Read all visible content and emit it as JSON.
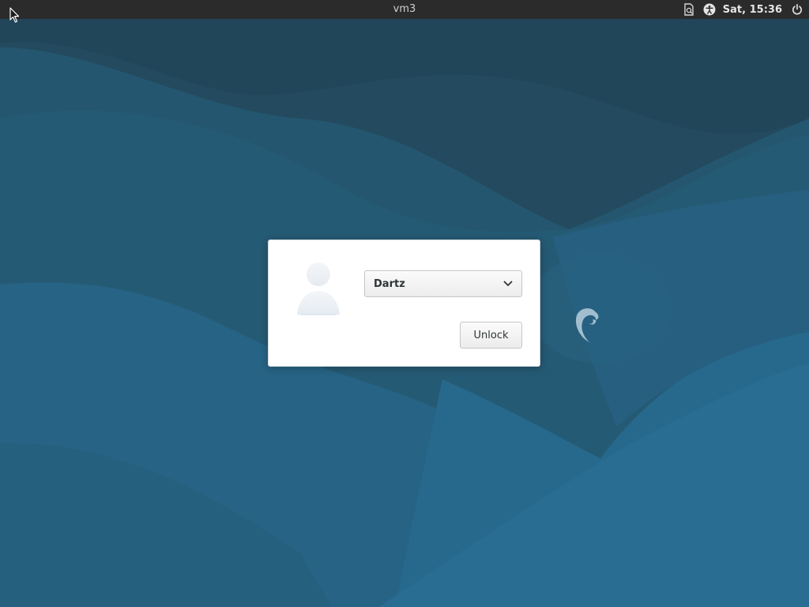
{
  "top_panel": {
    "hostname": "vm3",
    "clock": "Sat, 15:36",
    "icons": [
      "document-status-icon",
      "accessibility-icon",
      "power-icon"
    ]
  },
  "unlock_dialog": {
    "user_dropdown": {
      "selected": "Dartz"
    },
    "unlock_label": "Unlock"
  },
  "colors": {
    "panel_bg": "#2b2b2b",
    "wallpaper_base": "#245a78",
    "dialog_bg": "#ffffff"
  }
}
